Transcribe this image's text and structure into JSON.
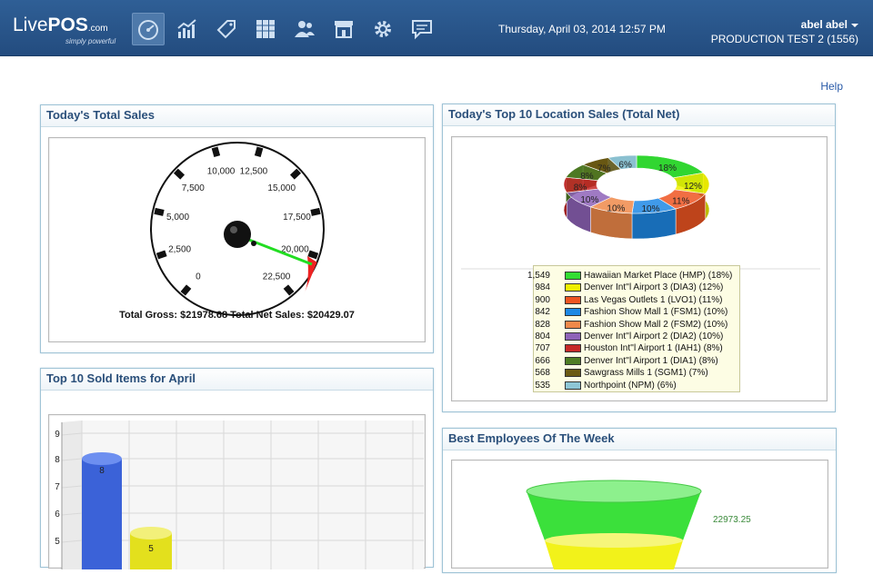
{
  "header": {
    "logo": {
      "live": "Live",
      "pos": "POS",
      "com": ".com",
      "tagline": "simply powerful"
    },
    "nav_icons": [
      "dashboard-icon",
      "reports-icon",
      "price-tag-icon",
      "inventory-icon",
      "users-icon",
      "store-icon",
      "settings-icon",
      "messages-icon"
    ],
    "datetime": "Thursday, April 03, 2014 12:57 PM",
    "user_name": "abel abel",
    "location": "PRODUCTION TEST 2 (1556)"
  },
  "help_link": "Help",
  "panels": {
    "total_sales": {
      "title": "Today's Total Sales"
    },
    "top_locations": {
      "title": "Today's Top 10 Location Sales (Total Net)"
    },
    "top_items": {
      "title": "Top 10 Sold Items for April"
    },
    "best_employees": {
      "title": "Best Employees Of The Week"
    }
  },
  "gauge": {
    "ticks": [
      "0",
      "2,500",
      "5,000",
      "7,500",
      "10,000",
      "12,500",
      "15,000",
      "17,500",
      "20,000",
      "22,500"
    ],
    "caption": "Total Gross: $21978.68  Total Net Sales: $20429.07"
  },
  "donut_labels": [
    "18%",
    "12%",
    "11%",
    "10%",
    "10%",
    "10%",
    "8%",
    "8%",
    "7%",
    "6%"
  ],
  "legend": [
    {
      "value": "1,549",
      "name": "Hawaiian Market Place (HMP) (18%)",
      "color": "#33dd33"
    },
    {
      "value": "984",
      "name": "Denver Int''l Airport 3 (DIA3) (12%)",
      "color": "#eeee00"
    },
    {
      "value": "900",
      "name": "Las Vegas Outlets 1 (LVO1) (11%)",
      "color": "#ee5522"
    },
    {
      "value": "842",
      "name": "Fashion Show Mall 1 (FSM1) (10%)",
      "color": "#1e88e5"
    },
    {
      "value": "828",
      "name": "Fashion Show Mall 2 (FSM2) (10%)",
      "color": "#f0894a"
    },
    {
      "value": "804",
      "name": "Denver Int''l Airport 2 (DIA2) (10%)",
      "color": "#8e63b8"
    },
    {
      "value": "707",
      "name": "Houston Int''l Airport 1 (IAH1) (8%)",
      "color": "#c62828"
    },
    {
      "value": "666",
      "name": "Denver Int''l Airport 1 (DIA1) (8%)",
      "color": "#4f7d24"
    },
    {
      "value": "568",
      "name": "Sawgrass Mills 1 (SGM1) (7%)",
      "color": "#6b5a14"
    },
    {
      "value": "535",
      "name": "Northpoint (NPM) (6%)",
      "color": "#8ec6d6"
    }
  ],
  "bar_axis": [
    "9",
    "8",
    "7",
    "6",
    "5"
  ],
  "bar_labels": [
    "8",
    "5"
  ],
  "funnel_label": "22973.25"
}
